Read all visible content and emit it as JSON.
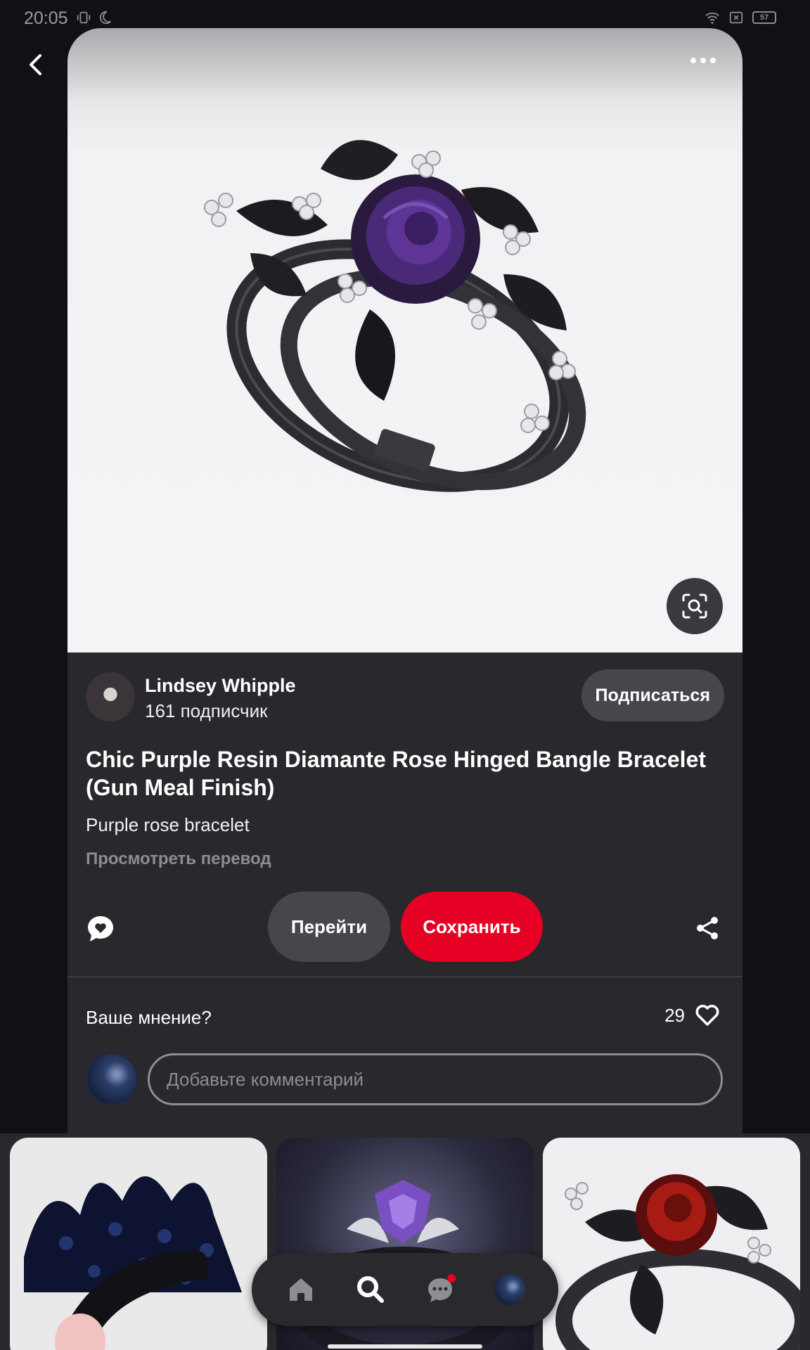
{
  "status_bar": {
    "time": "20:05",
    "battery": "57",
    "icons": [
      "vibrate-icon",
      "do-not-disturb-icon",
      "wifi-icon",
      "sim-off-icon",
      "battery-icon"
    ]
  },
  "pin": {
    "title": "Chic Purple Resin Diamante Rose Hinged Bangle Bracelet (Gun Meal Finish)",
    "description": "Purple rose bracelet",
    "translate_label": "Просмотреть перевод"
  },
  "author": {
    "name": "Lindsey Whipple",
    "followers": "161 подписчик",
    "follow_label": "Подписаться"
  },
  "actions": {
    "visit_label": "Перейти",
    "save_label": "Сохранить"
  },
  "feedback": {
    "prompt": "Ваше мнение?",
    "likes": "29",
    "comment_placeholder": "Добавьте комментарий"
  },
  "colors": {
    "save": "#e60023",
    "card": "#29282d",
    "background": "#111015"
  }
}
